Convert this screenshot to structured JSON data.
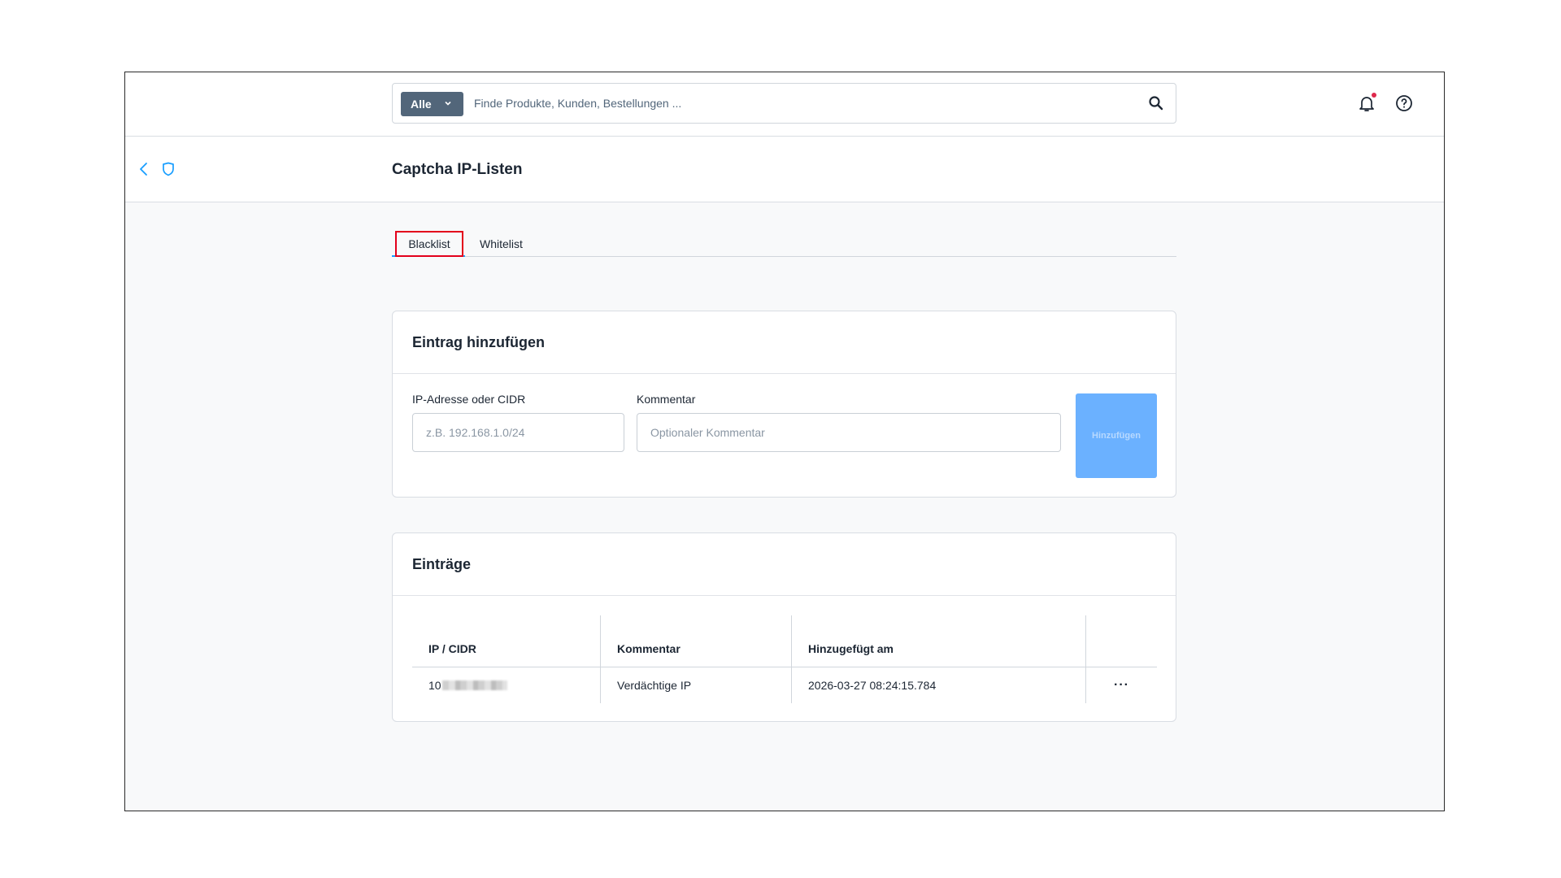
{
  "header": {
    "search_type": "Alle",
    "search_placeholder": "Finde Produkte, Kunden, Bestellungen ..."
  },
  "page": {
    "title": "Captcha IP-Listen"
  },
  "tabs": [
    {
      "label": "Blacklist",
      "active": true
    },
    {
      "label": "Whitelist",
      "active": false
    }
  ],
  "add_card": {
    "title": "Eintrag hinzufügen",
    "ip_label": "IP-Adresse oder CIDR",
    "ip_placeholder": "z.B. 192.168.1.0/24",
    "comment_label": "Kommentar",
    "comment_placeholder": "Optionaler Kommentar",
    "add_button": "Hinzufügen"
  },
  "entries_card": {
    "title": "Einträge",
    "columns": [
      "IP / CIDR",
      "Kommentar",
      "Hinzugefügt am"
    ],
    "rows": [
      {
        "ip": "10",
        "comment": "Verdächtige IP",
        "added": "2026-03-27 08:24:15.784",
        "actions": "···"
      }
    ]
  },
  "colors": {
    "accent": "#189eff",
    "highlight_box": "#e3001b",
    "button_disabled": "#6bb1ff",
    "search_type_bg": "#52667a"
  }
}
